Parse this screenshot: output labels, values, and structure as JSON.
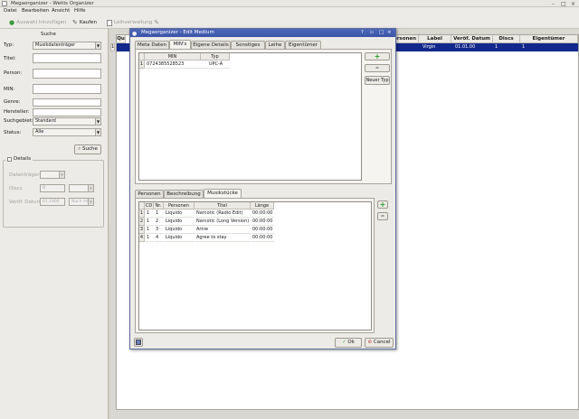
{
  "window": {
    "title": "Megaorganizer - Weitis Organizer"
  },
  "menu": [
    "Datei",
    "Bearbeiten",
    "Ansicht",
    "Hilfe"
  ],
  "toolbar": {
    "disabled_item": "Auswahl hinzufügen",
    "buy": "Kaufen",
    "lend": "Leihverwaltung"
  },
  "search": {
    "header": "Suche",
    "type_label": "Typ:",
    "type_value": "Musikdatenträger",
    "title_label": "Titel:",
    "person_label": "Person:",
    "min_label": "MIN:",
    "genre_label": "Genre:",
    "maker_label": "Hersteller:",
    "area_label": "Suchgebiet:",
    "area_value": "Standard",
    "status_label": "Status:",
    "status_value": "Alle",
    "search_button": "Suche",
    "details_label": "Details",
    "carrier_label": "Datenträger",
    "discs_label": "Discs",
    "discs_value": "0",
    "release_label": "Veröf. Datum",
    "release_value": "01.1900",
    "after_value": "Nach im"
  },
  "maintable": {
    "headers": [
      "Qu",
      "Personen",
      "Label",
      "Veröf. Datum",
      "Discs",
      "Eigentümer"
    ],
    "row": {
      "label": "Virgin",
      "date": "01.01.00",
      "discs": "1",
      "owner": "1"
    }
  },
  "dialog": {
    "title": "Megaorganizer - Edit Medium",
    "tabs": [
      "Meta Daten",
      "MIN's",
      "Eigene Details",
      "Sonstiges",
      "Leihe",
      "Eigentümer"
    ],
    "min_headers": [
      "",
      "MIN",
      "Typ"
    ],
    "min_rows": [
      {
        "idx": "1",
        "min": "0724385528523",
        "typ": "UPC-A"
      }
    ],
    "new_type_button": "Neuer Typ",
    "lower_tabs": [
      "Personen",
      "Beschreibung",
      "Musikstücke"
    ],
    "track_headers": [
      "",
      "CD",
      "Nr.",
      "Personen",
      "Titel",
      "Länge"
    ],
    "tracks": [
      {
        "row": "1",
        "cd": "1",
        "nr": "1",
        "person": "Liquido",
        "title": "Narcotic (Radio Edit)",
        "length": "00:00:00"
      },
      {
        "row": "2",
        "cd": "1",
        "nr": "2",
        "person": "Liquido",
        "title": "Narcotic (Long Version)",
        "length": "00:00:00"
      },
      {
        "row": "3",
        "cd": "1",
        "nr": "3",
        "person": "Liquido",
        "title": "Arnie",
        "length": "00:00:00"
      },
      {
        "row": "4",
        "cd": "1",
        "nr": "4",
        "person": "Liquido",
        "title": "Agree to stay",
        "length": "00:00:00"
      }
    ],
    "ok_button": "Ok",
    "cancel_button": "Cancel"
  }
}
